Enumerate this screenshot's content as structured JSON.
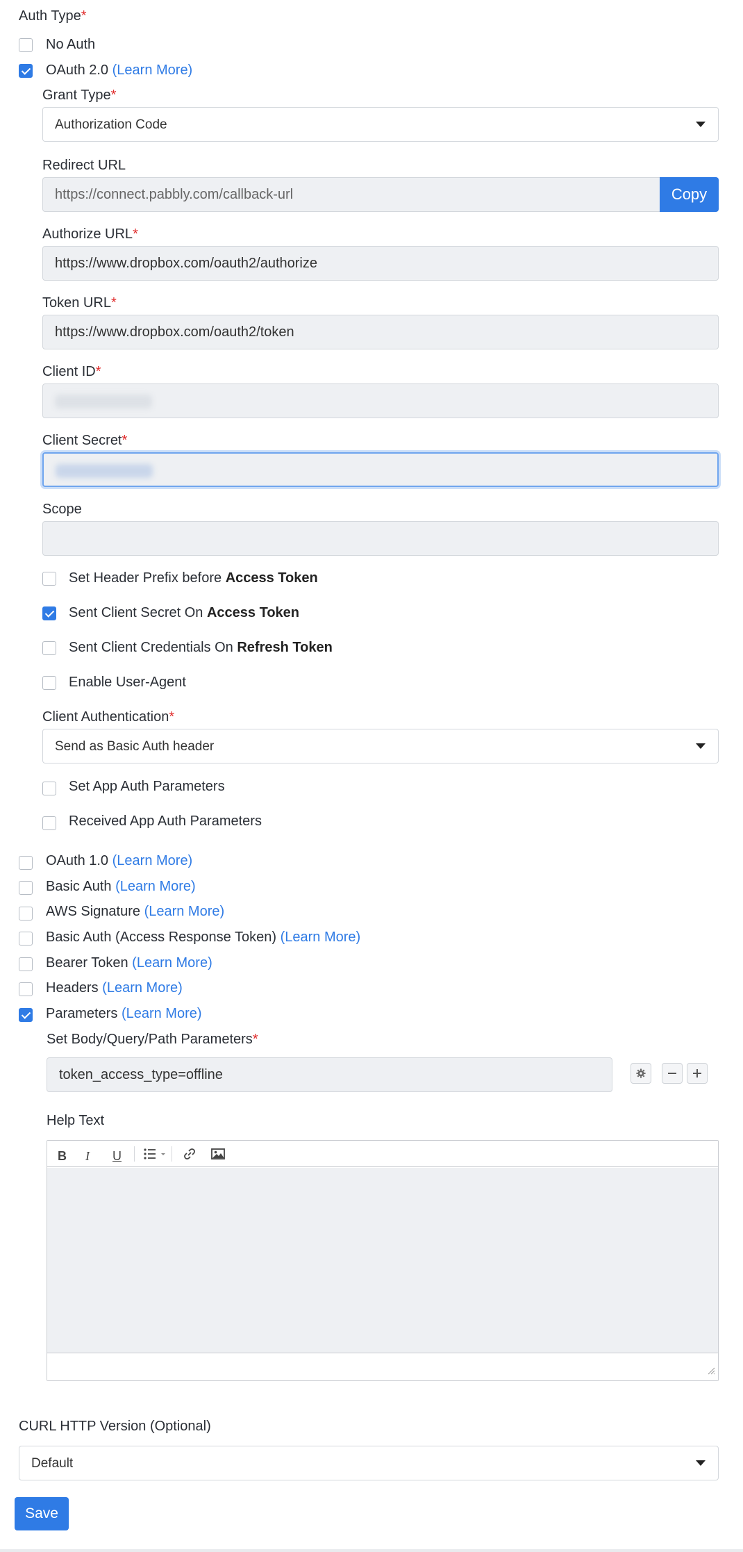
{
  "auth": {
    "label": "Auth Type",
    "required": "*",
    "learn_more": "(Learn More)",
    "no_auth": "No Auth",
    "oauth2": "OAuth 2.0",
    "oauth1": "OAuth 1.0",
    "basic_auth": "Basic Auth",
    "aws": "AWS Signature",
    "basic_access": "Basic Auth (Access Response Token)",
    "bearer": "Bearer Token",
    "headers": "Headers",
    "parameters": "Parameters"
  },
  "oauth": {
    "grant_type_label": "Grant Type",
    "grant_type_value": "Authorization Code",
    "redirect_label": "Redirect URL",
    "redirect_value": "https://connect.pabbly.com/callback-url",
    "copy": "Copy",
    "authorize_label": "Authorize URL",
    "authorize_value": "https://www.dropbox.com/oauth2/authorize",
    "token_label": "Token URL",
    "token_value": "https://www.dropbox.com/oauth2/token",
    "client_id_label": "Client ID",
    "client_secret_label": "Client Secret",
    "scope_label": "Scope",
    "opt_header_prefix": "Set Header Prefix before ",
    "opt_sent_secret": "Sent Client Secret On ",
    "opt_sent_credentials": "Sent Client Credentials On ",
    "access_token": "Access Token",
    "refresh_token": "Refresh Token",
    "opt_user_agent": "Enable User-Agent",
    "client_auth_label": "Client Authentication",
    "client_auth_value": "Send as Basic Auth header",
    "opt_set_app_params": "Set App Auth Parameters",
    "opt_received_app_params": "Received App Auth Parameters"
  },
  "params": {
    "label": "Set Body/Query/Path Parameters",
    "value": "token_access_type=offline",
    "help_label": "Help Text",
    "toolbar": [
      "B",
      "I",
      "U"
    ]
  },
  "curl": {
    "label": "CURL HTTP Version (Optional)",
    "value": "Default"
  },
  "save": "Save",
  "icons": {
    "gear": "gear-icon",
    "minus": "minus-icon",
    "plus": "plus-icon",
    "list": "list-icon",
    "link": "link-icon",
    "image": "image-icon"
  },
  "colors": {
    "accent": "#2f7be5",
    "required": "#e02b2b"
  }
}
